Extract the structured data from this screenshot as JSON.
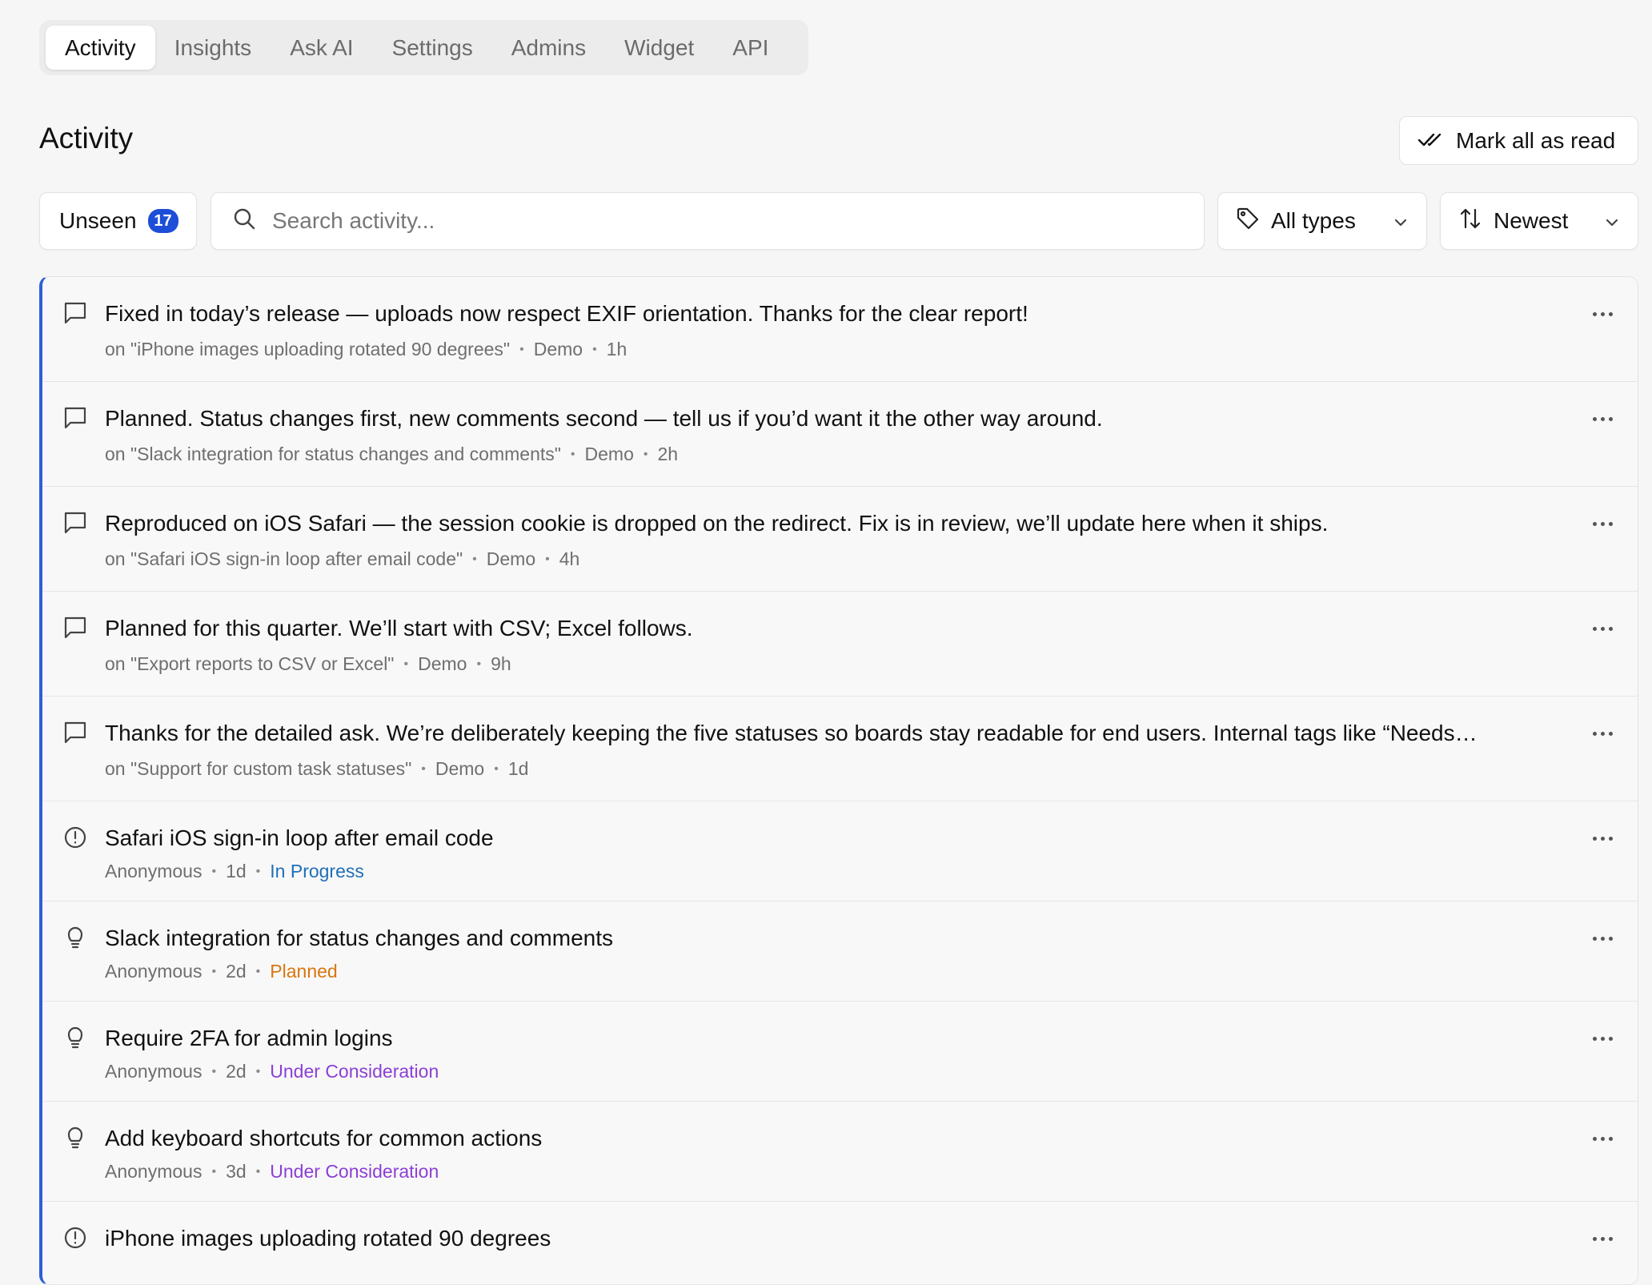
{
  "tabs": [
    {
      "label": "Activity",
      "active": true
    },
    {
      "label": "Insights"
    },
    {
      "label": "Ask AI"
    },
    {
      "label": "Settings"
    },
    {
      "label": "Admins"
    },
    {
      "label": "Widget"
    },
    {
      "label": "API"
    }
  ],
  "header": {
    "title": "Activity",
    "mark_all_label": "Mark all as read"
  },
  "filters": {
    "unseen_label": "Unseen",
    "unseen_count": "17",
    "search_placeholder": "Search activity...",
    "types_label": "All types",
    "sort_label": "Newest"
  },
  "colors": {
    "accent": "#1d4ed8",
    "in_progress": "#1f6fb8",
    "planned": "#d9760f",
    "under_consideration": "#8b3fd6"
  },
  "items": [
    {
      "icon": "comment-icon",
      "title": "Fixed in today’s release — uploads now respect EXIF orientation. Thanks for the clear report!",
      "context": "on \"iPhone images uploading rotated 90 degrees\"",
      "author": "Demo",
      "time": "1h"
    },
    {
      "icon": "comment-icon",
      "title": "Planned. Status changes first, new comments second — tell us if you’d want it the other way around.",
      "context": "on \"Slack integration for status changes and comments\"",
      "author": "Demo",
      "time": "2h"
    },
    {
      "icon": "comment-icon",
      "title": "Reproduced on iOS Safari — the session cookie is dropped on the redirect. Fix is in review, we’ll update here when it ships.",
      "context": "on \"Safari iOS sign-in loop after email code\"",
      "author": "Demo",
      "time": "4h"
    },
    {
      "icon": "comment-icon",
      "title": "Planned for this quarter. We’ll start with CSV; Excel follows.",
      "context": "on \"Export reports to CSV or Excel\"",
      "author": "Demo",
      "time": "9h"
    },
    {
      "icon": "comment-icon",
      "title": "Thanks for the detailed ask. We’re deliberately keeping the five statuses so boards stay readable for end users. Internal tags like “Needs…",
      "context": "on \"Support for custom task statuses\"",
      "author": "Demo",
      "time": "1d"
    },
    {
      "icon": "alert-circle-icon",
      "title": "Safari iOS sign-in loop after email code",
      "author": "Anonymous",
      "time": "1d",
      "status": "In Progress"
    },
    {
      "icon": "lightbulb-icon",
      "title": "Slack integration for status changes and comments",
      "author": "Anonymous",
      "time": "2d",
      "status": "Planned"
    },
    {
      "icon": "lightbulb-icon",
      "title": "Require 2FA for admin logins",
      "author": "Anonymous",
      "time": "2d",
      "status": "Under Consideration"
    },
    {
      "icon": "lightbulb-icon",
      "title": "Add keyboard shortcuts for common actions",
      "author": "Anonymous",
      "time": "3d",
      "status": "Under Consideration"
    },
    {
      "icon": "alert-circle-icon",
      "title": "iPhone images uploading rotated 90 degrees",
      "author": "",
      "time": ""
    }
  ]
}
